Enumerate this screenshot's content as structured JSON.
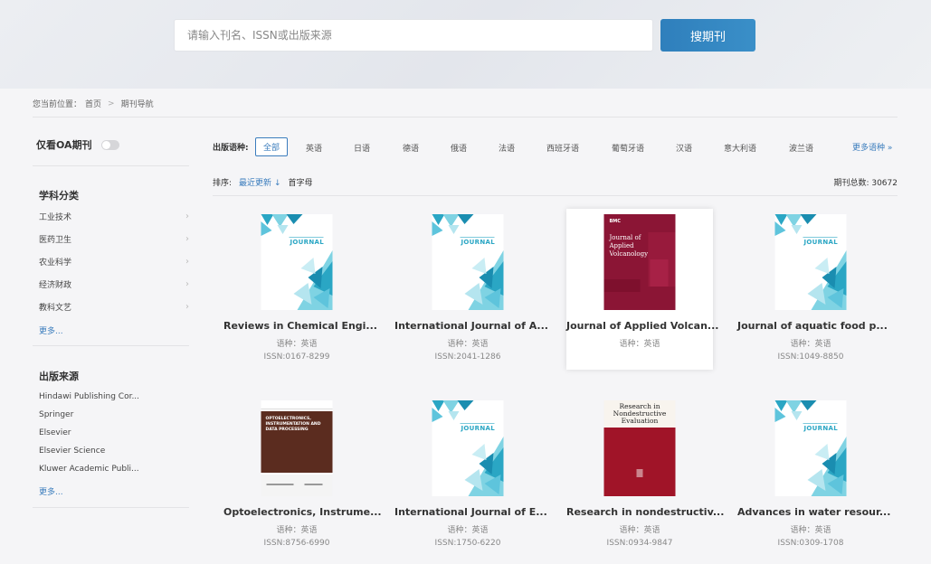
{
  "search": {
    "placeholder": "请输入刊名、ISSN或出版来源",
    "button_label": "搜期刊"
  },
  "breadcrumb": {
    "prefix": "您当前位置：",
    "home": "首页",
    "separator": ">",
    "current": "期刊导航"
  },
  "sidebar": {
    "oa_label": "仅看OA期刊",
    "subject_title": "学科分类",
    "subjects": [
      "工业技术",
      "医药卫生",
      "农业科学",
      "经济财政",
      "教科文艺"
    ],
    "subject_more": "更多...",
    "publisher_title": "出版来源",
    "publishers": [
      "Hindawi Publishing Cor...",
      "Springer",
      "Elsevier",
      "Elsevier Science",
      "Kluwer Academic Publi..."
    ],
    "publisher_more": "更多..."
  },
  "filter": {
    "label": "出版语种:",
    "languages": [
      "全部",
      "英语",
      "日语",
      "德语",
      "俄语",
      "法语",
      "西班牙语",
      "葡萄牙语",
      "汉语",
      "意大利语",
      "波兰语"
    ],
    "more": "更多语种"
  },
  "sort": {
    "label": "排序:",
    "latest": "最近更新",
    "latest_arrow": "↓",
    "alpha": "首字母"
  },
  "total": {
    "label": "期刊总数:",
    "value": "30672"
  },
  "journals": [
    {
      "title": "Reviews in Chemical Engi...",
      "lang": "语种：英语",
      "issn": "ISSN:0167-8299",
      "cover": "journal"
    },
    {
      "title": "International Journal of A...",
      "lang": "语种：英语",
      "issn": "ISSN:2041-1286",
      "cover": "journal"
    },
    {
      "title": "Journal of Applied Volcan...",
      "lang": "语种：英语",
      "issn": "",
      "cover": "bmc"
    },
    {
      "title": "Journal of aquatic food p...",
      "lang": "语种：英语",
      "issn": "ISSN:1049-8850",
      "cover": "journal"
    },
    {
      "title": "Optoelectronics, Instrume...",
      "lang": "语种：英语",
      "issn": "ISSN:8756-6990",
      "cover": "opto"
    },
    {
      "title": "International Journal of E...",
      "lang": "语种：英语",
      "issn": "ISSN:1750-6220",
      "cover": "journal"
    },
    {
      "title": "Research in nondestructiv...",
      "lang": "语种：英语",
      "issn": "ISSN:0934-9847",
      "cover": "research"
    },
    {
      "title": "Advances in water resour...",
      "lang": "语种：英语",
      "issn": "ISSN:0309-1708",
      "cover": "journal"
    }
  ],
  "covers": {
    "journal_word": "JOURNAL",
    "bmc_brand": "BMC",
    "bmc_title": "Journal of Applied Volcanology",
    "opto_title": "OPTOELECTRONICS, INSTRUMENTATION AND DATA PROCESSING",
    "research_title": "Research in Nondestructive Evaluation"
  },
  "colors": {
    "accent": "#3b7dbd",
    "teal_light": "#7fd3e3",
    "teal_dark": "#2aa6c4",
    "bmc_cover": "#8b1535",
    "opto_cover": "#5b2c1f",
    "research_cover": "#a01428"
  }
}
